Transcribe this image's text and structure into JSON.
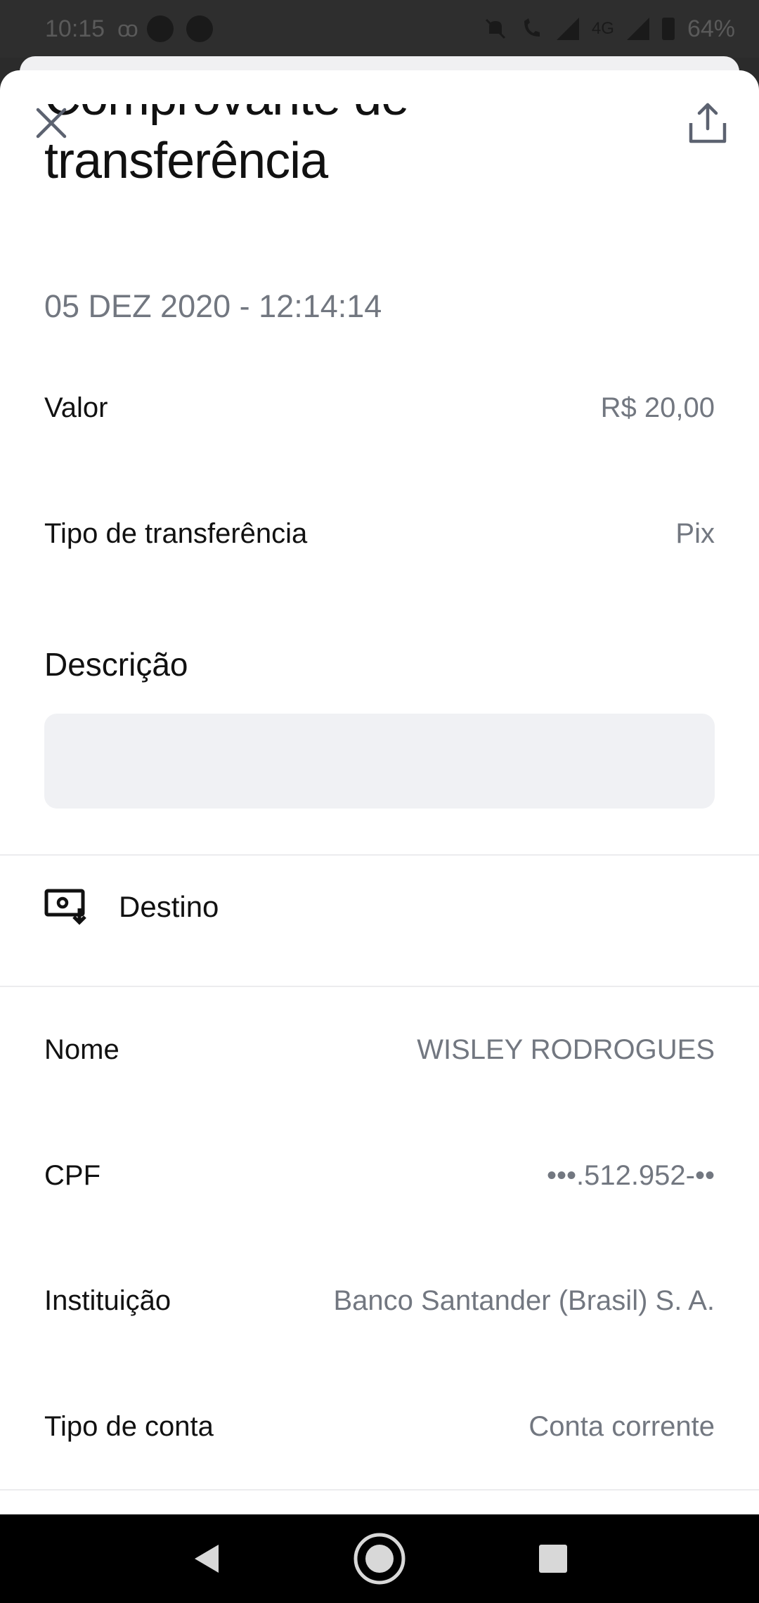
{
  "status_bar": {
    "time": "10:15",
    "network_label": "4G",
    "battery": "64%"
  },
  "header": {
    "title": "Comprovante de transferência",
    "datetime": "05 DEZ 2020 - 12:14:14"
  },
  "details": {
    "valor_label": "Valor",
    "valor_value": "R$ 20,00",
    "tipo_label": "Tipo de transferência",
    "tipo_value": "Pix"
  },
  "descricao": {
    "title": "Descrição",
    "value": ""
  },
  "destino": {
    "title": "Destino",
    "icon": "screen-download-icon",
    "nome_label": "Nome",
    "nome_value": "WISLEY RODROGUES",
    "cpf_label": "CPF",
    "cpf_value": "•••.512.952-••",
    "instituicao_label": "Instituição",
    "instituicao_value": "Banco Santander (Brasil) S. A.",
    "conta_label": "Tipo de conta",
    "conta_value": "Conta corrente"
  },
  "colors": {
    "text_primary": "#111111",
    "text_secondary": "#727780",
    "box_bg": "#f0f1f4"
  }
}
